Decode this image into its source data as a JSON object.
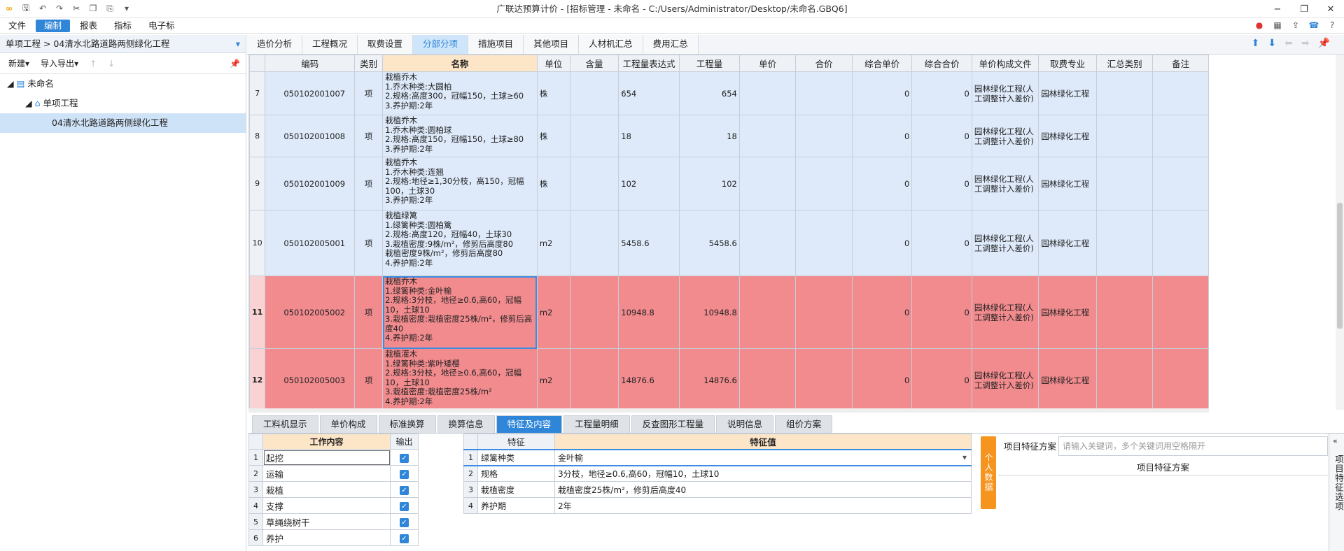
{
  "app": {
    "title": "广联达预算计价 - [招标管理 - 未命名 - C:/Users/Administrator/Desktop/未命名.GBQ6]"
  },
  "menu": [
    "文件",
    "编制",
    "报表",
    "指标",
    "电子标"
  ],
  "menu_active_index": 1,
  "left": {
    "breadcrumb": "单项工程 > 04清水北路道路两侧绿化工程",
    "new_label": "新建",
    "import_export_label": "导入导出",
    "tree": [
      {
        "label": "未命名",
        "level": 0
      },
      {
        "label": "单项工程",
        "level": 1
      },
      {
        "label": "04清水北路道路两侧绿化工程",
        "level": 2,
        "selected": true
      }
    ]
  },
  "top_tabs": [
    "造价分析",
    "工程概况",
    "取费设置",
    "分部分项",
    "措施项目",
    "其他项目",
    "人材机汇总",
    "费用汇总"
  ],
  "top_tab_active": 3,
  "grid": {
    "headers": [
      "",
      "编码",
      "类别",
      "名称",
      "单位",
      "含量",
      "工程量表达式",
      "工程量",
      "单价",
      "合价",
      "综合单价",
      "综合合价",
      "单价构成文件",
      "取费专业",
      "汇总类别",
      "备注"
    ],
    "rows": [
      {
        "no": "7",
        "code": "050102001007",
        "type": "项",
        "name": "栽植乔木\n1.乔木种类:大圆柏\n2.规格:高度300，冠幅150，土球≥60\n3.养护期:2年",
        "unit": "株",
        "expr": "654",
        "qty": "654",
        "unit_price": "0",
        "total": "0",
        "file": "园林绿化工程(人工调整计入差价)",
        "major": "园林绿化工程",
        "style": "blue"
      },
      {
        "no": "8",
        "code": "050102001008",
        "type": "项",
        "name": "栽植乔木\n1.乔木种类:圆柏球\n2.规格:高度150，冠幅150，土球≥80\n3.养护期:2年",
        "unit": "株",
        "expr": "18",
        "qty": "18",
        "unit_price": "0",
        "total": "0",
        "file": "园林绿化工程(人工调整计入差价)",
        "major": "园林绿化工程",
        "style": "blue"
      },
      {
        "no": "9",
        "code": "050102001009",
        "type": "项",
        "name": "栽植乔木\n1.乔木种类:连翘\n2.规格:地径≥1,30分枝，高150，冠幅100，土球30\n3.养护期:2年",
        "unit": "株",
        "expr": "102",
        "qty": "102",
        "unit_price": "0",
        "total": "0",
        "file": "园林绿化工程(人工调整计入差价)",
        "major": "园林绿化工程",
        "style": "blue"
      },
      {
        "no": "10",
        "code": "050102005001",
        "type": "项",
        "name": "栽植绿篱\n1.绿篱种类:圆柏篱\n2.规格:高度120，冠幅40，土球30\n3.栽植密度:9株/m²，修剪后高度80\n栽植密度9株/m²，修剪后高度80\n4.养护期:2年",
        "unit": "m2",
        "expr": "5458.6",
        "qty": "5458.6",
        "unit_price": "0",
        "total": "0",
        "file": "园林绿化工程(人工调整计入差价)",
        "major": "园林绿化工程",
        "style": "blue"
      },
      {
        "no": "11",
        "code": "050102005002",
        "type": "项",
        "name": "栽植乔木\n1.绿篱种类:金叶榆\n2.规格:3分枝，地径≥0.6,高60，冠幅10，土球10\n3.栽植密度:栽植密度25株/m²，修剪后高度40\n4.养护期:2年",
        "unit": "m2",
        "expr": "10948.8",
        "qty": "10948.8",
        "unit_price": "0",
        "total": "0",
        "file": "园林绿化工程(人工调整计入差价)",
        "major": "园林绿化工程",
        "style": "red",
        "focus": true
      },
      {
        "no": "12",
        "code": "050102005003",
        "type": "项",
        "name": "栽植灌木\n1.绿篱种类:紫叶矮樱\n2.规格:3分枝，地径≥0.6,高60，冠幅10，土球10\n3.栽植密度:栽植密度25株/m²\n4.养护期:2年",
        "unit": "m2",
        "expr": "14876.6",
        "qty": "14876.6",
        "unit_price": "0",
        "total": "0",
        "file": "园林绿化工程(人工调整计入差价)",
        "major": "园林绿化工程",
        "style": "red"
      }
    ]
  },
  "bottom_tabs": [
    "工料机显示",
    "单价构成",
    "标准换算",
    "换算信息",
    "特征及内容",
    "工程量明细",
    "反查图形工程量",
    "说明信息",
    "组价方案"
  ],
  "bottom_tab_active": 4,
  "work": {
    "headers": [
      "",
      "工作内容",
      "输出"
    ],
    "rows": [
      "起挖",
      "运输",
      "栽植",
      "支撑",
      "草绳绕树干",
      "养护"
    ]
  },
  "features": {
    "headers": [
      "",
      "特征",
      "特征值"
    ],
    "rows": [
      {
        "name": "绿篱种类",
        "value": "金叶榆"
      },
      {
        "name": "规格",
        "value": "3分枝，地径≥0.6,高60，冠幅10，土球10"
      },
      {
        "name": "栽植密度",
        "value": "栽植密度25株/m²，修剪后高度40"
      },
      {
        "name": "养护期",
        "value": "2年"
      }
    ]
  },
  "personal_data_label": "个人数据",
  "scheme": {
    "label": "项目特征方案",
    "placeholder": "请输入关键词，多个关键词用空格隔开",
    "header": "项目特征方案"
  },
  "side_option_label": "项目特征选项"
}
